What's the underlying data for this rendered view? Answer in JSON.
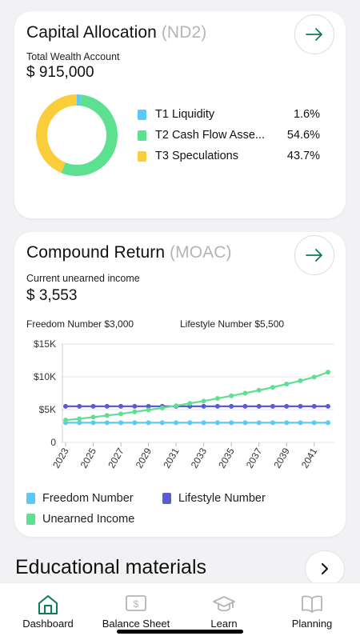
{
  "capital": {
    "title": "Capital Allocation",
    "title_suffix": "(ND2)",
    "account_label": "Total Wealth Account",
    "account_value": "$ 915,000",
    "items": [
      {
        "label": "T1 Liquidity",
        "pct_text": "1.6%",
        "value": 1.6,
        "color": "#5ac8fa"
      },
      {
        "label": "T2 Cash Flow Asse...",
        "pct_text": "54.6%",
        "value": 54.6,
        "color": "#5de08f"
      },
      {
        "label": "T3 Speculations",
        "pct_text": "43.7%",
        "value": 43.7,
        "color": "#fccd3a"
      }
    ]
  },
  "compound": {
    "title": "Compound Return",
    "title_suffix": "(MOAC)",
    "income_label": "Current unearned income",
    "income_value": "$ 3,553",
    "freedom_text": "Freedom Number $3,000",
    "lifestyle_text": "Lifestyle Number $5,500"
  },
  "chart_data": {
    "type": "line",
    "x": [
      2023,
      2024,
      2025,
      2026,
      2027,
      2028,
      2029,
      2030,
      2031,
      2032,
      2033,
      2034,
      2035,
      2036,
      2037,
      2038,
      2039,
      2040,
      2041,
      2042
    ],
    "x_tick_labels": [
      "2023",
      "2025",
      "2027",
      "2029",
      "2031",
      "2033",
      "2035",
      "2037",
      "2039",
      "2041"
    ],
    "y_tick_labels": [
      "0",
      "$5K",
      "$10K",
      "$15K"
    ],
    "y_ticks": [
      0,
      5000,
      10000,
      15000
    ],
    "ylim": [
      0,
      15000
    ],
    "series": [
      {
        "name": "Freedom Number",
        "color": "#5ac8fa",
        "values": [
          3000,
          3000,
          3000,
          3000,
          3000,
          3000,
          3000,
          3000,
          3000,
          3000,
          3000,
          3000,
          3000,
          3000,
          3000,
          3000,
          3000,
          3000,
          3000,
          3000
        ]
      },
      {
        "name": "Lifestyle Number",
        "color": "#5b5bd6",
        "values": [
          5500,
          5500,
          5500,
          5500,
          5500,
          5500,
          5500,
          5500,
          5500,
          5500,
          5500,
          5500,
          5500,
          5500,
          5500,
          5500,
          5500,
          5500,
          5500,
          5500
        ]
      },
      {
        "name": "Unearned Income",
        "color": "#5de08f",
        "values": [
          3400,
          3600,
          3850,
          4100,
          4350,
          4650,
          4950,
          5250,
          5600,
          5950,
          6300,
          6700,
          7100,
          7500,
          7950,
          8400,
          8900,
          9400,
          9950,
          10700
        ]
      }
    ]
  },
  "education": {
    "title": "Educational materials"
  },
  "nav": [
    {
      "label": "Dashboard",
      "icon": "home-icon"
    },
    {
      "label": "Balance Sheet",
      "icon": "dollar-bill-icon"
    },
    {
      "label": "Learn",
      "icon": "graduation-cap-icon"
    },
    {
      "label": "Planning",
      "icon": "open-book-icon"
    }
  ],
  "colors": {
    "accent": "#0f7a5a",
    "inactive": "#b5b5b5"
  }
}
